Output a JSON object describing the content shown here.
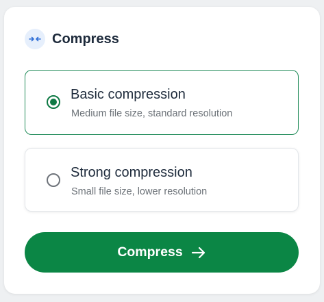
{
  "header": {
    "title": "Compress",
    "icon": "compress-arrows-icon"
  },
  "options": [
    {
      "title": "Basic compression",
      "description": "Medium file size, standard resolution",
      "selected": true
    },
    {
      "title": "Strong compression",
      "description": "Small file size, lower resolution",
      "selected": false
    }
  ],
  "action": {
    "label": "Compress",
    "icon": "arrow-right-icon"
  },
  "colors": {
    "accent": "#0b8645",
    "selected_border": "#1e8a57",
    "icon_blue": "#2f6fd6",
    "icon_bg": "#e6effc"
  }
}
